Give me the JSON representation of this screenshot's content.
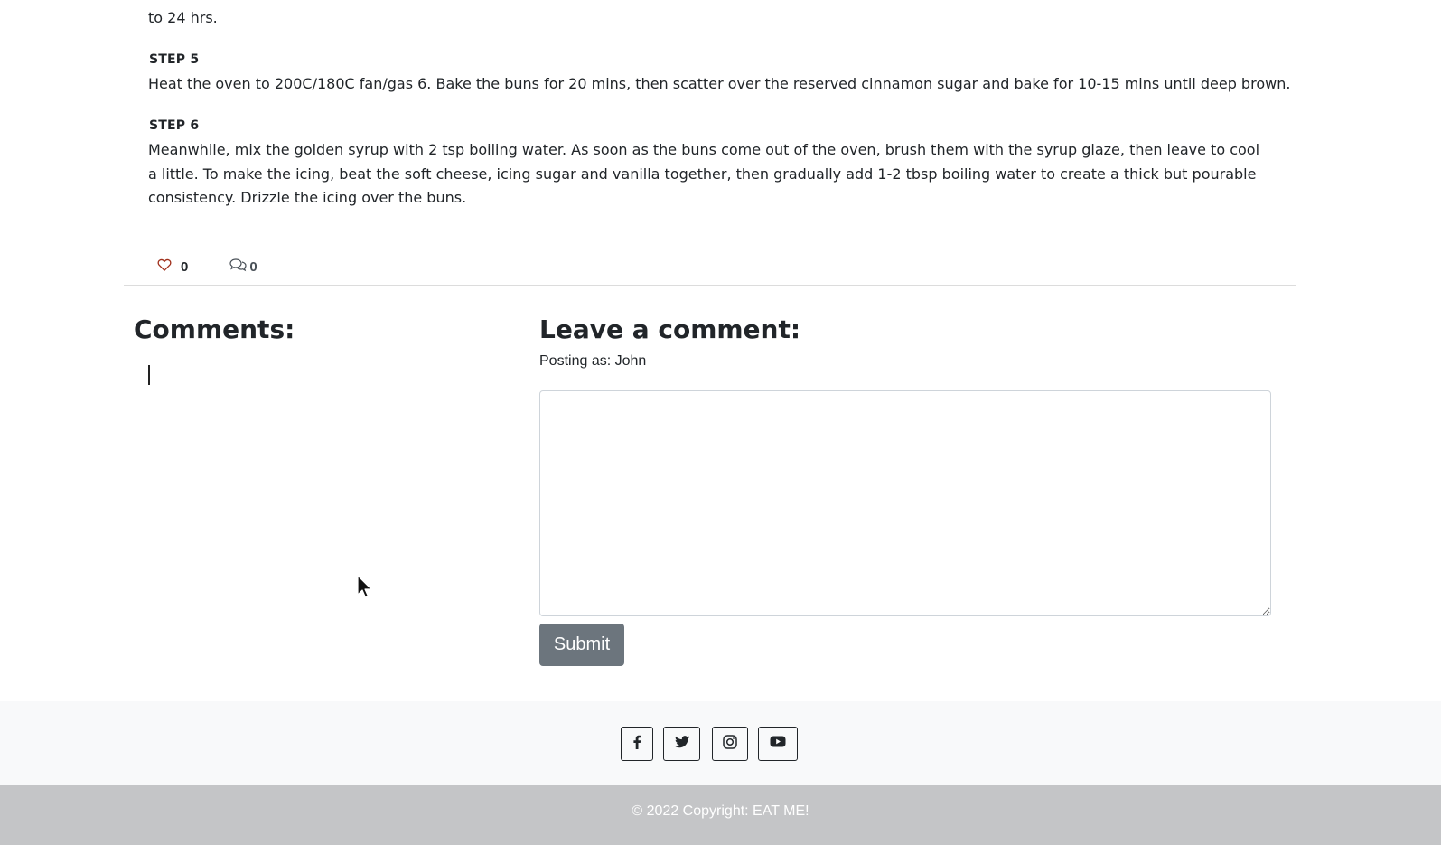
{
  "recipe": {
    "step4_tail": "to 24 hrs.",
    "steps": [
      {
        "title": "STEP 5",
        "text": "Heat the oven to 200C/180C fan/gas 6. Bake the buns for 20 mins, then scatter over the reserved cinnamon sugar and bake for 10-15 mins until deep brown."
      },
      {
        "title": "STEP 6",
        "text": "Meanwhile, mix the golden syrup with 2 tsp boiling water. As soon as the buns come out of the oven, brush them with the syrup glaze, then leave to cool a little. To make the icing, beat the soft cheese, icing sugar and vanilla together, then gradually add 1-2 tbsp boiling water to create a thick but pourable consistency. Drizzle the icing over the buns."
      }
    ]
  },
  "stats": {
    "likes": "0",
    "comments": "0",
    "like_icon": "heart-icon",
    "comment_icon": "chat-icon",
    "like_color": "#a0301c"
  },
  "comments": {
    "heading": "Comments:"
  },
  "comment_form": {
    "heading": "Leave a comment:",
    "posting_as": "Posting as: John",
    "textarea_value": "",
    "submit_label": "Submit",
    "submit_color": "#6c757d"
  },
  "footer": {
    "social": [
      {
        "name": "facebook",
        "icon": "facebook-icon"
      },
      {
        "name": "twitter",
        "icon": "twitter-icon"
      },
      {
        "name": "instagram",
        "icon": "instagram-icon"
      },
      {
        "name": "youtube",
        "icon": "youtube-icon"
      }
    ],
    "copyright": "© 2022 Copyright: EAT ME!"
  }
}
